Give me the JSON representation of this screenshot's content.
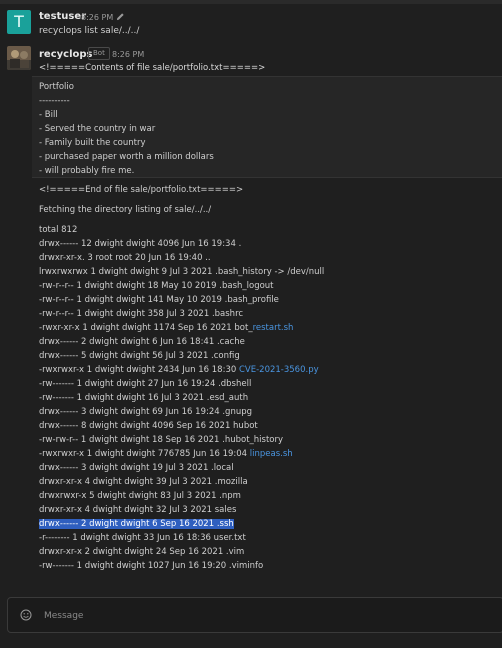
{
  "messages": [
    {
      "user": "testuser",
      "time": "8:26 PM",
      "avatar_letter": "T",
      "text": "recyclops list sale/../../"
    },
    {
      "user": "recyclops",
      "badge": "Bot",
      "time": "8:26 PM",
      "contents_header": "<!=====Contents of file sale/portfolio.txt=====>",
      "file_lines": [
        "Portfolio",
        "----------",
        "- Bill",
        "- Served the country in war",
        "- Family built the country",
        "- purchased paper worth a million dollars",
        "- will probably fire me."
      ],
      "contents_footer": "<!=====End of file sale/portfolio.txt=====>",
      "fetching": "Fetching the directory listing of sale/../../",
      "listing": [
        {
          "text": "total 812"
        },
        {
          "text": "drwx------ 12 dwight dwight 4096 Jun 16 19:34 ."
        },
        {
          "text": "drwxr-xr-x. 3 root root 20 Jun 16 19:40 .."
        },
        {
          "text": "lrwxrwxrwx 1 dwight dwight 9 Jul 3 2021 .bash_history -> /dev/null"
        },
        {
          "text": "-rw-r--r-- 1 dwight dwight 18 May 10 2019 .bash_logout"
        },
        {
          "text": "-rw-r--r-- 1 dwight dwight 141 May 10 2019 .bash_profile"
        },
        {
          "text": "-rw-r--r-- 1 dwight dwight 358 Jul 3 2021 .bashrc"
        },
        {
          "text": "-rwxr-xr-x 1 dwight dwight 1174 Sep 16 2021 bot_",
          "link": "restart.sh"
        },
        {
          "text": "drwx------ 2 dwight dwight 6 Jun 16 18:41 .cache"
        },
        {
          "text": "drwx------ 5 dwight dwight 56 Jul 3 2021 .config"
        },
        {
          "text": "-rwxrwxr-x 1 dwight dwight 2434 Jun 16 18:30 ",
          "link": "CVE-2021-3560.py"
        },
        {
          "text": "-rw------- 1 dwight dwight 27 Jun 16 19:24 .dbshell"
        },
        {
          "text": "-rw------- 1 dwight dwight 16 Jul 3 2021 .esd_auth"
        },
        {
          "text": "drwx------ 3 dwight dwight 69 Jun 16 19:24 .gnupg"
        },
        {
          "text": "drwx------ 8 dwight dwight 4096 Sep 16 2021 hubot"
        },
        {
          "text": "-rw-rw-r-- 1 dwight dwight 18 Sep 16 2021 .hubot_history"
        },
        {
          "text": "-rwxrwxr-x 1 dwight dwight 776785 Jun 16 19:04 ",
          "link": "linpeas.sh"
        },
        {
          "text": "drwx------ 3 dwight dwight 19 Jul 3 2021 .local"
        },
        {
          "text": "drwxr-xr-x 4 dwight dwight 39 Jul 3 2021 .mozilla"
        },
        {
          "text": "drwxrwxr-x 5 dwight dwight 83 Jul 3 2021 .npm"
        },
        {
          "text": "drwxr-xr-x 4 dwight dwight 32 Jul 3 2021 sales"
        },
        {
          "text": "drwx------ 2 dwight dwight 6 Sep 16 2021 .ssh",
          "selected": true
        },
        {
          "text": "-r-------- 1 dwight dwight 33 Jun 16 18:36 user.txt"
        },
        {
          "text": "drwxr-xr-x 2 dwight dwight 24 Sep 16 2021 .vim"
        },
        {
          "text": "-rw------- 1 dwight dwight 1027 Jun 16 19:20 .viminfo"
        }
      ]
    }
  ],
  "composer": {
    "placeholder": "Message",
    "emoji_icon": "smiley-icon"
  },
  "icons": {
    "edit": "pencil-icon"
  },
  "colors": {
    "background": "#1f1f1f",
    "avatar_t": "#1aa19a",
    "link": "#4a95e0",
    "selection": "#2f5fbf"
  }
}
